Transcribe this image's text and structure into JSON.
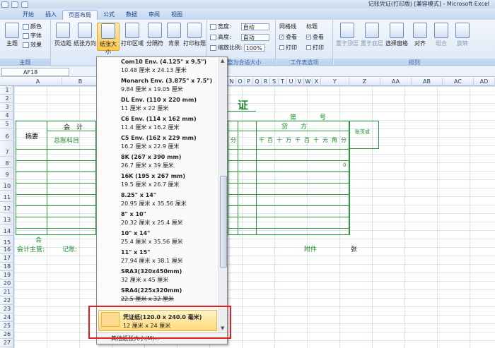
{
  "window": {
    "title": "记账凭证(打印版) [兼容模式] - Microsoft Excel"
  },
  "tabs": [
    "开始",
    "插入",
    "页面布局",
    "公式",
    "数据",
    "审阅",
    "视图"
  ],
  "active_tab": "页面布局",
  "ribbon": {
    "theme_group": {
      "label": "主题",
      "main": "主题",
      "colors": "颜色",
      "fonts": "字体",
      "effects": "效果"
    },
    "page_setup_group": {
      "margins": "页边距",
      "orientation": "纸张方向",
      "size": "纸张大小",
      "print_area": "打印区域",
      "breaks": "分隔符",
      "background": "背景",
      "print_titles": "打印标题"
    },
    "scale_group": {
      "label": "调整为合适大小",
      "width_label": "宽度:",
      "width_value": "自动",
      "height_label": "高度:",
      "height_value": "自动",
      "scale_label": "缩放比例:",
      "scale_value": "100%"
    },
    "sheet_options": {
      "label": "工作表选项",
      "gridlines": "网格线",
      "headings": "标题",
      "view": "查看",
      "print": "打印"
    },
    "arrange_group": {
      "label": "排列",
      "bring_front": "置于顶层",
      "send_back": "置于底层",
      "selection_pane": "选择窗格",
      "align": "对齐",
      "group": "组合",
      "rotate": "旋转"
    }
  },
  "formula_bar": {
    "name_box": "AF18"
  },
  "columns": [
    "A",
    "B",
    "N",
    "O",
    "P",
    "Q",
    "R",
    "S",
    "T",
    "U",
    "V",
    "W",
    "X",
    "Y",
    "Z",
    "AA",
    "AB",
    "AC",
    "AD"
  ],
  "rows": [
    "1",
    "2",
    "3",
    "4",
    "5",
    "6",
    "7",
    "8",
    "9",
    "10",
    "11",
    "12",
    "13",
    "14",
    "15",
    "16",
    "17",
    "18",
    "19",
    "20",
    "21",
    "22",
    "23",
    "24",
    "25",
    "26",
    "27"
  ],
  "sheet": {
    "title_fragment": "证",
    "no_label": "第",
    "no_suffix": "号",
    "summary_header": "摘要",
    "account_header_part": "会　计",
    "general_account": "总账科目",
    "credit_header": "贷　　方",
    "amount_units": [
      "分",
      "千",
      "百",
      "十",
      "万",
      "千",
      "百",
      "十",
      "元",
      "角",
      "分"
    ],
    "attachment_header": "账页或",
    "zero_value": "0",
    "total_label": "合",
    "accounting_supervisor": "会计主管:",
    "bookkeeper": "记账:",
    "attachments": "附件",
    "sheets_unit": "张"
  },
  "paper_size_menu": {
    "items": [
      {
        "name": "Com10 Env. (4.125\" x 9.5\")",
        "size": "10.48 厘米 x 24.13 厘米"
      },
      {
        "name": "Monarch Env. (3.875\" x 7.5\")",
        "size": "9.84 厘米 x 19.05 厘米"
      },
      {
        "name": "DL Env. (110 x 220 mm)",
        "size": "11 厘米 x 22 厘米"
      },
      {
        "name": "C6 Env. (114 x 162 mm)",
        "size": "11.4 厘米 x 16.2 厘米"
      },
      {
        "name": "C5 Env. (162 x 229 mm)",
        "size": "16.2 厘米 x 22.9 厘米"
      },
      {
        "name": "8K (267 x 390 mm)",
        "size": "26.7 厘米 x 39 厘米"
      },
      {
        "name": "16K (195 x 267 mm)",
        "size": "19.5 厘米 x 26.7 厘米"
      },
      {
        "name": "8.25\" x 14\"",
        "size": "20.95 厘米 x 35.56 厘米"
      },
      {
        "name": "8\" x 10\"",
        "size": "20.32 厘米 x 25.4 厘米"
      },
      {
        "name": "10\" x 14\"",
        "size": "25.4 厘米 x 35.56 厘米"
      },
      {
        "name": "11\" x 15\"",
        "size": "27.94 厘米 x 38.1 厘米"
      },
      {
        "name": "SRA3(320x450mm)",
        "size": "32 厘米 x 45 厘米"
      },
      {
        "name": "SRA4(225x320mm)",
        "size": "22.5 厘米 x 32 厘米"
      },
      {
        "name": "凭证纸(120.0 x 240.0 毫米)",
        "size": "12 厘米 x 24 厘米"
      }
    ],
    "selected": "凭证纸(120.0 x 240.0 毫米)",
    "more": "其他纸张大小(M)..."
  }
}
